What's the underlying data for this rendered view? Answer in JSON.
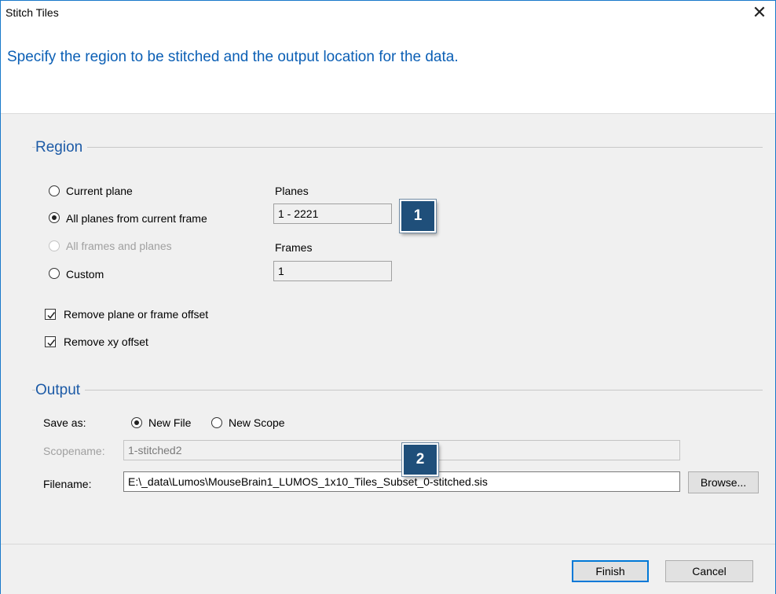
{
  "window": {
    "title": "Stitch Tiles",
    "close_label": "✕",
    "instruction": "Specify the region to be stitched and the output location for the data."
  },
  "region": {
    "heading": "Region",
    "options": [
      {
        "label": "Current plane",
        "selected": false,
        "enabled": true
      },
      {
        "label": "All planes from current frame",
        "selected": true,
        "enabled": true
      },
      {
        "label": "All frames and planes",
        "selected": false,
        "enabled": false
      },
      {
        "label": "Custom",
        "selected": false,
        "enabled": true
      }
    ],
    "planes_label": "Planes",
    "planes_value": "1 - 2221",
    "frames_label": "Frames",
    "frames_value": "1",
    "remove_plane_offset_label": "Remove plane or frame offset",
    "remove_plane_offset_checked": true,
    "remove_xy_offset_label": "Remove xy offset",
    "remove_xy_offset_checked": true
  },
  "output": {
    "heading": "Output",
    "save_as_label": "Save as:",
    "new_file_label": "New File",
    "new_file_selected": true,
    "new_scope_label": "New Scope",
    "new_scope_selected": false,
    "scopename_label": "Scopename:",
    "scopename_value": "1-stitched2",
    "filename_label": "Filename:",
    "filename_value": "E:\\_data\\Lumos\\MouseBrain1_LUMOS_1x10_Tiles_Subset_0-stitched.sis",
    "browse_label": "Browse..."
  },
  "callouts": {
    "one": "1",
    "two": "2"
  },
  "buttons": {
    "finish": "Finish",
    "cancel": "Cancel"
  },
  "colors": {
    "accent": "#1979ca",
    "heading_blue": "#1c5aa6",
    "callout_bg": "#1f4f7a"
  }
}
